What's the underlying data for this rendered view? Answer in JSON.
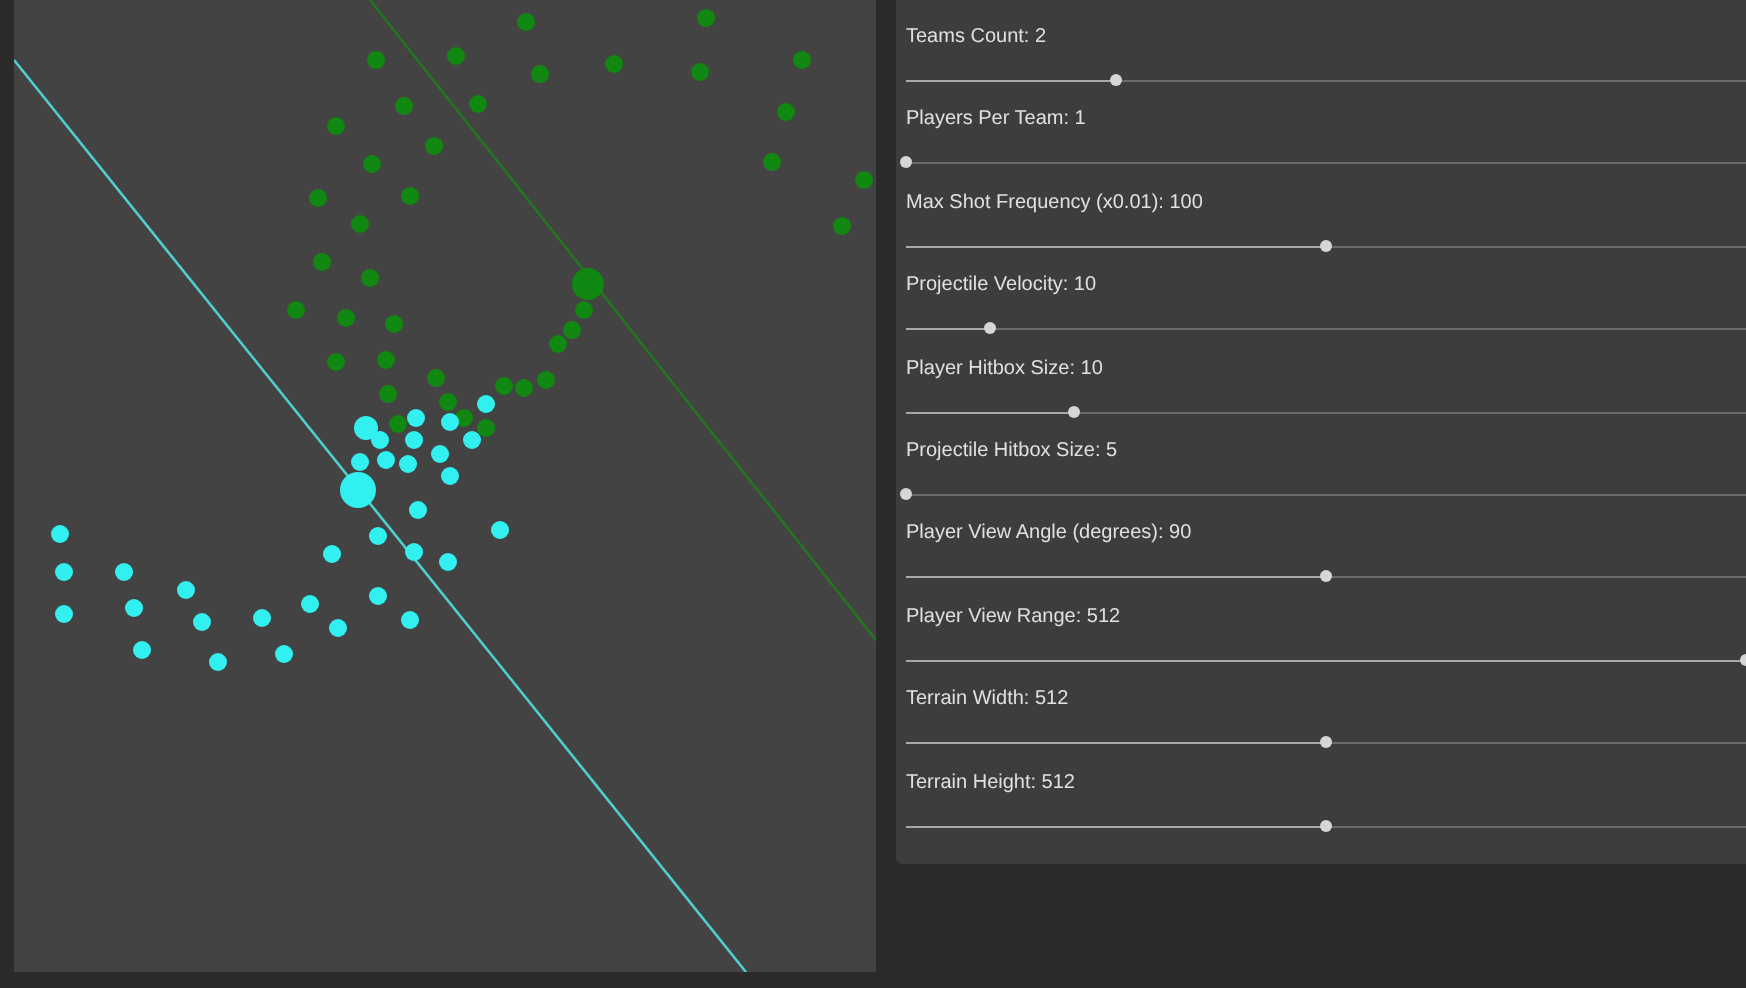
{
  "settings": [
    {
      "label": "Teams Count: 2",
      "level": 0.25
    },
    {
      "label": "Players Per Team: 1",
      "level": 0
    },
    {
      "label": "Max Shot Frequency (x0.01): 100",
      "level": 0.5
    },
    {
      "label": "Projectile Velocity: 10",
      "level": 0.1
    },
    {
      "label": "Player Hitbox Size: 10",
      "level": 0.2
    },
    {
      "label": "Projectile Hitbox Size: 5",
      "level": 0
    },
    {
      "label": "Player View Angle (degrees): 90",
      "level": 0.5
    },
    {
      "label": "Player View Range: 512",
      "level": 1
    },
    {
      "label": "Terrain Width: 512",
      "level": 0.5
    },
    {
      "label": "Terrain Height: 512",
      "level": 0.5
    }
  ]
}
